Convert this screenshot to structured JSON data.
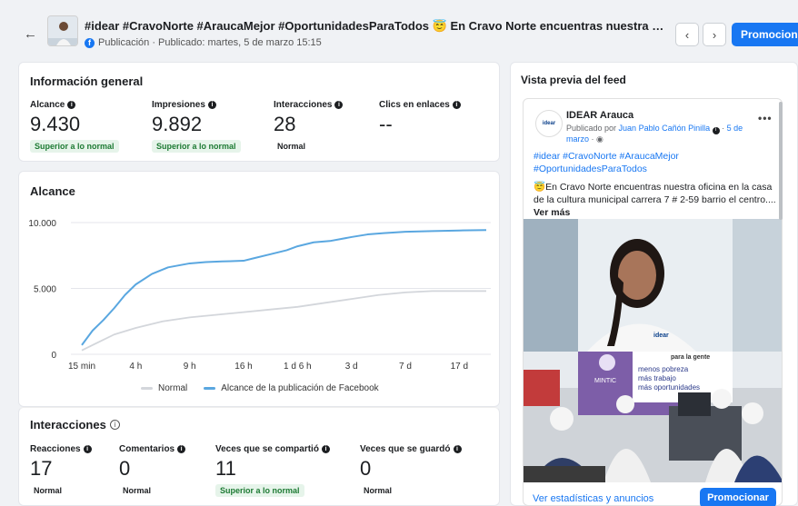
{
  "header": {
    "back_icon": "arrow-left-icon",
    "title": "#idear #CravoNorte #AraucaMejor #OportunidadesParaTodos 😇 En Cravo Norte encuentras nuestra oficina en la c...",
    "subtitle": "Publicación · Publicado: martes, 5 de marzo 15:15",
    "prev_symbol": "‹",
    "next_symbol": "›",
    "promote_label": "Promocionar",
    "accent_color": "#1877f2"
  },
  "general": {
    "title": "Información general",
    "metrics": [
      {
        "label": "Alcance",
        "value": "9.430",
        "badge": "Superior a lo normal"
      },
      {
        "label": "Impresiones",
        "value": "9.892",
        "badge": "Superior a lo normal"
      },
      {
        "label": "Interacciones",
        "value": "28",
        "badge": "Normal"
      },
      {
        "label": "Clics en enlaces",
        "value": "--",
        "badge": ""
      }
    ]
  },
  "reach_chart": {
    "title": "Alcance",
    "legend_normal": "Normal",
    "legend_post": "Alcance de la publicación de Facebook"
  },
  "chart_data": {
    "type": "line",
    "title": "Alcance",
    "x_tick_labels": [
      "15 min",
      "4 h",
      "9 h",
      "16 h",
      "1 d 6 h",
      "3 d",
      "7 d",
      "17 d"
    ],
    "y_tick_labels": [
      "10.000",
      "5.000",
      "0"
    ],
    "ylim": [
      0,
      10000
    ],
    "grid": true,
    "legend_position": "bottom",
    "series": [
      {
        "name": "Normal",
        "color": "#d3d6db",
        "points": [
          [
            0,
            300
          ],
          [
            0.3,
            900
          ],
          [
            0.6,
            1500
          ],
          [
            1.0,
            2000
          ],
          [
            1.5,
            2500
          ],
          [
            2.0,
            2800
          ],
          [
            2.5,
            3000
          ],
          [
            3.0,
            3200
          ],
          [
            3.5,
            3400
          ],
          [
            4.0,
            3600
          ],
          [
            4.5,
            3900
          ],
          [
            5.0,
            4200
          ],
          [
            5.5,
            4500
          ],
          [
            6.0,
            4700
          ],
          [
            6.5,
            4800
          ],
          [
            7.0,
            4800
          ],
          [
            7.5,
            4800
          ]
        ]
      },
      {
        "name": "Alcance de la publicación de Facebook",
        "color": "#5aa7e0",
        "points": [
          [
            0,
            700
          ],
          [
            0.2,
            1800
          ],
          [
            0.4,
            2600
          ],
          [
            0.6,
            3500
          ],
          [
            0.8,
            4500
          ],
          [
            1.0,
            5300
          ],
          [
            1.3,
            6100
          ],
          [
            1.6,
            6600
          ],
          [
            2.0,
            6900
          ],
          [
            2.3,
            7000
          ],
          [
            2.6,
            7050
          ],
          [
            3.0,
            7100
          ],
          [
            3.2,
            7300
          ],
          [
            3.5,
            7600
          ],
          [
            3.8,
            7900
          ],
          [
            4.0,
            8200
          ],
          [
            4.3,
            8500
          ],
          [
            4.6,
            8600
          ],
          [
            5.0,
            8900
          ],
          [
            5.3,
            9100
          ],
          [
            5.6,
            9200
          ],
          [
            6.0,
            9300
          ],
          [
            6.5,
            9350
          ],
          [
            7.0,
            9400
          ],
          [
            7.5,
            9430
          ]
        ]
      }
    ]
  },
  "interactions": {
    "title": "Interacciones",
    "info_icon": "info-circle-icon",
    "metrics": [
      {
        "label": "Reacciones",
        "value": "17",
        "badge": "Normal"
      },
      {
        "label": "Comentarios",
        "value": "0",
        "badge": "Normal"
      },
      {
        "label": "Veces que se compartió",
        "value": "11",
        "badge": "Superior a lo normal"
      },
      {
        "label": "Veces que se guardó",
        "value": "0",
        "badge": "Normal"
      }
    ]
  },
  "preview": {
    "title": "Vista previa del feed",
    "page_name": "IDEAR Arauca",
    "avatar_text": "idear",
    "published_by_prefix": "Publicado por ",
    "author": "Juan Pablo Cañón Pinilla",
    "date_link": "5 de marzo",
    "hashtags": "#idear #CravoNorte #AraucaMejor #OportunidadesParaTodos",
    "text": "😇En Cravo Norte encuentras nuestra oficina en la casa de la cultura municipal carrera 7 # 2-59  barrio el centro....",
    "see_more": "Ver más",
    "banner_line1": "menos pobreza",
    "banner_line2": "más trabajo",
    "banner_line3": "más oportunidades",
    "banner_top": "para la gente",
    "banner_mintic": "MINTIC",
    "shirt_logo": "idear",
    "footer_link": "Ver estadísticas y anuncios",
    "promote_label": "Promocionar"
  }
}
